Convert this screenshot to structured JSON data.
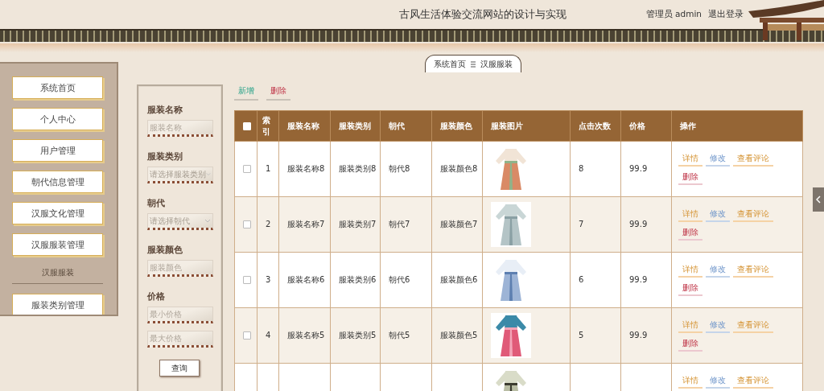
{
  "header": {
    "title": "古风生活体验交流网站的设计与实现",
    "user": "管理员 admin",
    "logout": "退出登录"
  },
  "breadcrumb": [
    "系统首页",
    "汉服服装"
  ],
  "sidebar": {
    "items": [
      {
        "label": "系统首页"
      },
      {
        "label": "个人中心"
      },
      {
        "label": "用户管理"
      },
      {
        "label": "朝代信息管理"
      },
      {
        "label": "汉服文化管理"
      },
      {
        "label": "汉服服装管理"
      }
    ],
    "section": "汉服服装",
    "sub_items": [
      {
        "label": "服装类别管理"
      }
    ]
  },
  "filters": [
    {
      "label": "服装名称",
      "fields": [
        {
          "kind": "text",
          "placeholder": "服装名称"
        }
      ]
    },
    {
      "label": "服装类别",
      "fields": [
        {
          "kind": "select",
          "placeholder": "请选择服装类别"
        }
      ]
    },
    {
      "label": "朝代",
      "fields": [
        {
          "kind": "select",
          "placeholder": "请选择朝代"
        }
      ]
    },
    {
      "label": "服装颜色",
      "fields": [
        {
          "kind": "text",
          "placeholder": "服装颜色"
        }
      ]
    },
    {
      "label": "价格",
      "fields": [
        {
          "kind": "text",
          "placeholder": "最小价格"
        },
        {
          "kind": "text",
          "placeholder": "最大价格"
        }
      ]
    }
  ],
  "search_button": "查询",
  "toolbar": [
    {
      "kind": "add",
      "label": "新增"
    },
    {
      "kind": "delete",
      "label": "删除"
    }
  ],
  "table": {
    "select_all": {
      "checked": false
    },
    "columns": [
      "索引",
      "服装名称",
      "服装类别",
      "朝代",
      "服装颜色",
      "服装图片",
      "点击次数",
      "价格",
      "操作"
    ],
    "rows": [
      {
        "checked": false,
        "index": "1",
        "name": "服装名称8",
        "category": "服装类别8",
        "dynasty": "朝代8",
        "garment_color": "服装颜色8",
        "clicks": "8",
        "price": "99.9",
        "actions": [
          {
            "kind": "detail",
            "label": "详情"
          },
          {
            "kind": "edit",
            "label": "修改"
          },
          {
            "kind": "detail",
            "label": "查看评论"
          },
          {
            "kind": "delete",
            "label": "删除"
          }
        ]
      },
      {
        "checked": false,
        "index": "2",
        "name": "服装名称7",
        "category": "服装类别7",
        "dynasty": "朝代7",
        "garment_color": "服装颜色7",
        "clicks": "7",
        "price": "99.9",
        "actions": [
          {
            "kind": "detail",
            "label": "详情"
          },
          {
            "kind": "edit",
            "label": "修改"
          },
          {
            "kind": "detail",
            "label": "查看评论"
          },
          {
            "kind": "delete",
            "label": "删除"
          }
        ]
      },
      {
        "checked": false,
        "index": "3",
        "name": "服装名称6",
        "category": "服装类别6",
        "dynasty": "朝代6",
        "garment_color": "服装颜色6",
        "clicks": "6",
        "price": "99.9",
        "actions": [
          {
            "kind": "detail",
            "label": "详情"
          },
          {
            "kind": "edit",
            "label": "修改"
          },
          {
            "kind": "detail",
            "label": "查看评论"
          },
          {
            "kind": "delete",
            "label": "删除"
          }
        ]
      },
      {
        "checked": false,
        "index": "4",
        "name": "服装名称5",
        "category": "服装类别5",
        "dynasty": "朝代5",
        "garment_color": "服装颜色5",
        "clicks": "5",
        "price": "99.9",
        "actions": [
          {
            "kind": "detail",
            "label": "详情"
          },
          {
            "kind": "edit",
            "label": "修改"
          },
          {
            "kind": "detail",
            "label": "查看评论"
          },
          {
            "kind": "delete",
            "label": "删除"
          }
        ]
      },
      {
        "actions": [
          {
            "kind": "detail",
            "label": "详情"
          },
          {
            "kind": "edit",
            "label": "修改"
          },
          {
            "kind": "detail",
            "label": "查看评论"
          }
        ]
      }
    ]
  }
}
